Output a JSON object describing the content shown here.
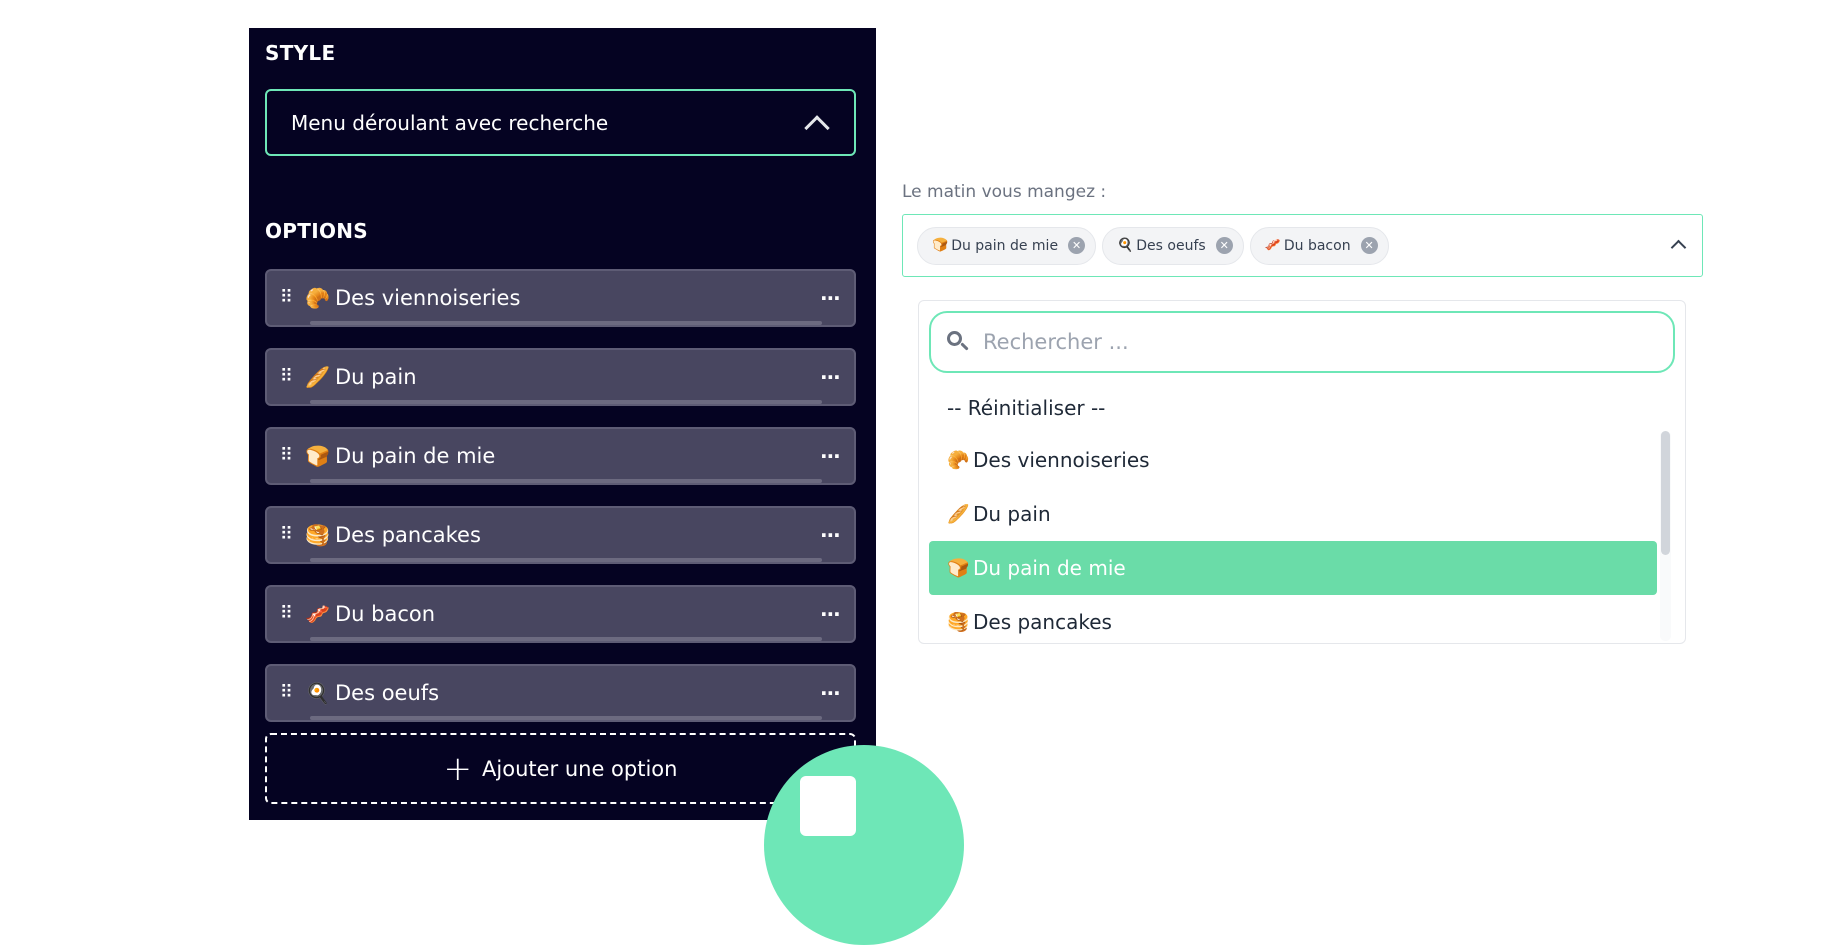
{
  "editor": {
    "style_title": "STYLE",
    "style_value": "Menu déroulant avec recherche",
    "options_title": "OPTIONS",
    "options": [
      {
        "emoji": "🥐",
        "label": "Des viennoiseries"
      },
      {
        "emoji": "🥖",
        "label": "Du pain"
      },
      {
        "emoji": "🍞",
        "label": "Du pain de mie"
      },
      {
        "emoji": "🥞",
        "label": "Des pancakes"
      },
      {
        "emoji": "🥓",
        "label": "Du bacon"
      },
      {
        "emoji": "🍳",
        "label": "Des oeufs"
      }
    ],
    "more_icon": "⋯",
    "drag_icon": "⠿",
    "add_option": "Ajouter une option"
  },
  "preview": {
    "question": "Le matin vous mangez :",
    "chips": [
      {
        "emoji": "🍞",
        "label": "Du pain de mie"
      },
      {
        "emoji": "🍳",
        "label": "Des oeufs"
      },
      {
        "emoji": "🥓",
        "label": "Du bacon"
      }
    ],
    "chip_remove": "✕",
    "search_placeholder": "Rechercher ...",
    "reset_label": "-- Réinitialiser --",
    "list": [
      {
        "emoji": "🥐",
        "label": "Des viennoiseries",
        "selected": false
      },
      {
        "emoji": "🥖",
        "label": "Du pain",
        "selected": false
      },
      {
        "emoji": "🍞",
        "label": "Du pain de mie",
        "selected": true
      },
      {
        "emoji": "🥞",
        "label": "Des pancakes",
        "selected": false
      }
    ]
  },
  "colors": {
    "panel_bg": "#050322",
    "accent": "#6ee7b7",
    "selected_bg": "#6adca8",
    "option_bg": "#484660"
  }
}
